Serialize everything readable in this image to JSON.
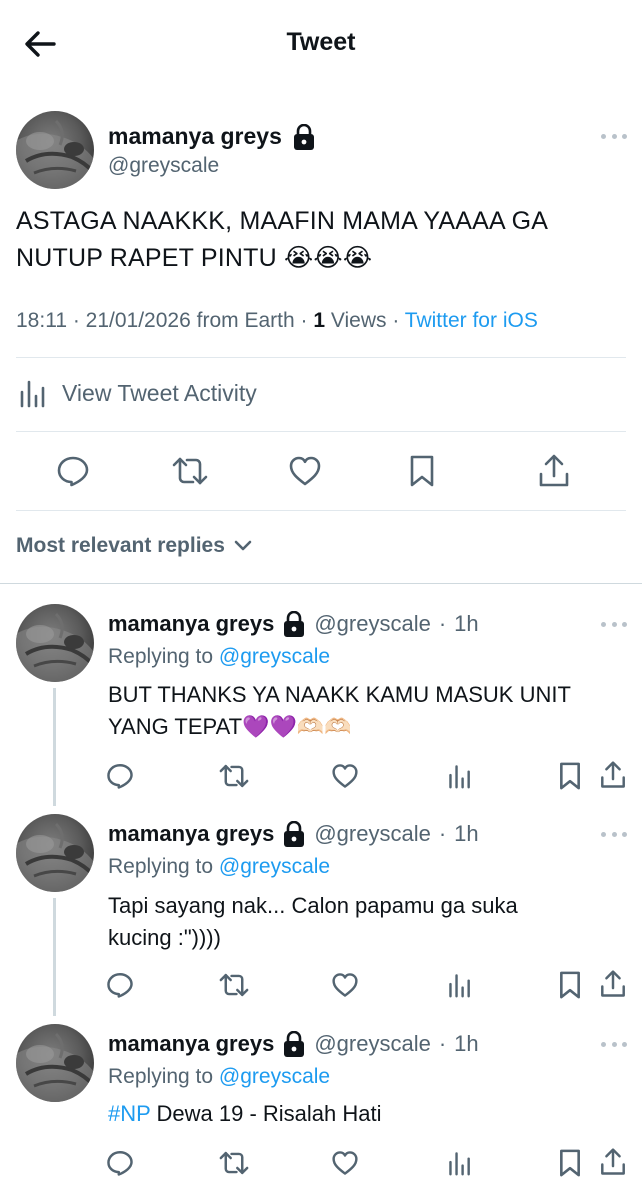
{
  "header": {
    "title": "Tweet",
    "back_icon": "arrow-left-icon"
  },
  "main_tweet": {
    "name": "mamanya greys",
    "handle": "@greyscale",
    "text": "ASTAGA NAAKKK, MAAFIN MAMA YAAAA GA NUTUP RAPET PINTU 😭😭😭",
    "time": "18:11",
    "date": "21/01/2026",
    "location": "from Earth",
    "views_count": "1",
    "views_label": "Views",
    "source": "Twitter for iOS"
  },
  "activity_label": "View Tweet Activity",
  "replies_sort_label": "Most relevant replies",
  "replies": [
    {
      "name": "mamanya greys",
      "handle": "@greyscale",
      "time": "1h",
      "replying_prefix": "Replying to",
      "replying_to": "@greyscale",
      "hashtag": "",
      "text": "BUT THANKS YA NAAKK KAMU MASUK UNIT YANG TEPAT💜💜🫶🏻🫶🏻"
    },
    {
      "name": "mamanya greys",
      "handle": "@greyscale",
      "time": "1h",
      "replying_prefix": "Replying to",
      "replying_to": "@greyscale",
      "hashtag": "",
      "text": "Tapi sayang nak... Calon papamu ga suka kucing :\"))))"
    },
    {
      "name": "mamanya greys",
      "handle": "@greyscale",
      "time": "1h",
      "replying_prefix": "Replying to",
      "replying_to": "@greyscale",
      "hashtag": "#NP",
      "text": "Dewa 19 - Risalah Hati"
    }
  ],
  "colors": {
    "link": "#1d9bf0",
    "text": "#0f1419",
    "secondary": "#536471",
    "divider": "#e1e8ed"
  }
}
